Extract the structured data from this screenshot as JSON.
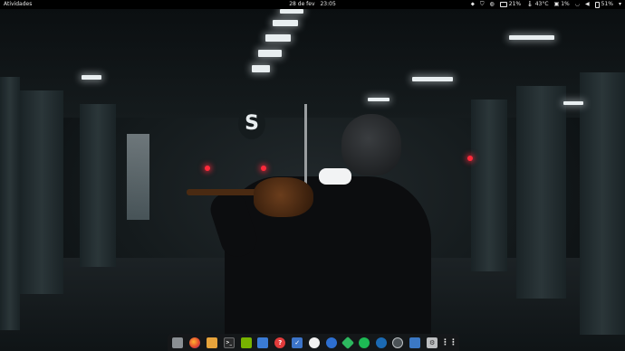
{
  "topbar": {
    "activities": "Atividades",
    "date": "28 de fev",
    "time": "23:05",
    "tray": {
      "cpu": "21%",
      "temp": "43°C",
      "disk": "1%",
      "battery": "51%"
    }
  },
  "wallpaper": {
    "sign_letter": "S"
  },
  "dock": {
    "apps": [
      {
        "name": "files",
        "glyph": ""
      },
      {
        "name": "firefox",
        "glyph": ""
      },
      {
        "name": "folder",
        "glyph": ""
      },
      {
        "name": "terminal",
        "glyph": ">_"
      },
      {
        "name": "nvidia",
        "glyph": ""
      },
      {
        "name": "docs",
        "glyph": ""
      },
      {
        "name": "blocker",
        "glyph": "?"
      },
      {
        "name": "tasks",
        "glyph": "✓"
      },
      {
        "name": "inkscape",
        "glyph": ""
      },
      {
        "name": "steam-alt",
        "glyph": ""
      },
      {
        "name": "gitkraken",
        "glyph": ""
      },
      {
        "name": "spotify",
        "glyph": ""
      },
      {
        "name": "steam",
        "glyph": ""
      },
      {
        "name": "clock",
        "glyph": ""
      },
      {
        "name": "system-monitor",
        "glyph": ""
      },
      {
        "name": "settings",
        "glyph": "⚙"
      },
      {
        "name": "app-grid",
        "glyph": "⋮⋮"
      }
    ]
  }
}
